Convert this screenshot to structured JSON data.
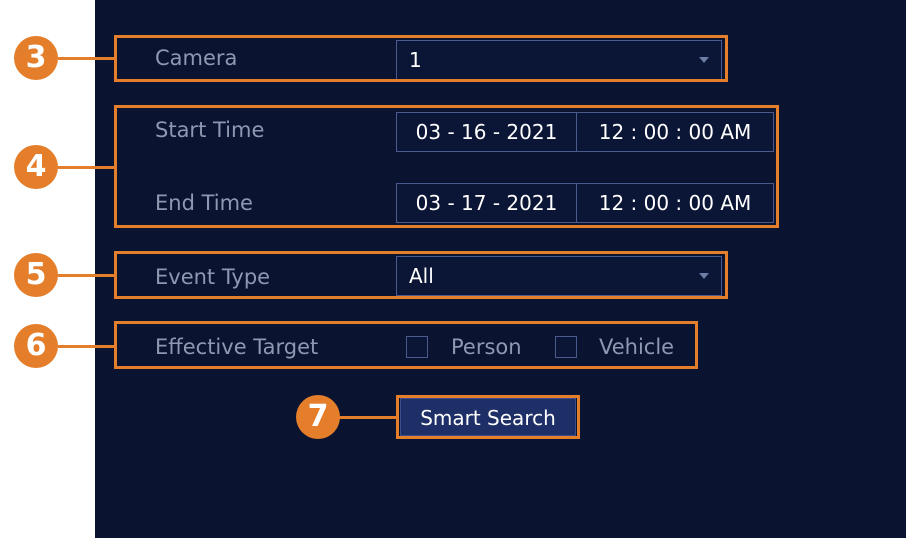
{
  "form": {
    "camera": {
      "label": "Camera",
      "value": "1"
    },
    "start_time": {
      "label": "Start Time",
      "date": "03 - 16 - 2021",
      "time": "12 : 00 : 00 AM"
    },
    "end_time": {
      "label": "End Time",
      "date": "03 - 17 - 2021",
      "time": "12 : 00 : 00 AM"
    },
    "event_type": {
      "label": "Event Type",
      "value": "All"
    },
    "effective_target": {
      "label": "Effective Target",
      "options": [
        {
          "label": "Person",
          "checked": false
        },
        {
          "label": "Vehicle",
          "checked": false
        }
      ]
    },
    "smart_search_label": "Smart Search"
  },
  "callouts": [
    "3",
    "4",
    "5",
    "6",
    "7"
  ],
  "colors": {
    "panel_bg": "#0a1431",
    "highlight": "#e47e2b",
    "field_border": "#4a5a8c",
    "label_text": "#8e98b0"
  },
  "icons": [
    "dropdown-arrow-icon",
    "checkbox-icon"
  ]
}
